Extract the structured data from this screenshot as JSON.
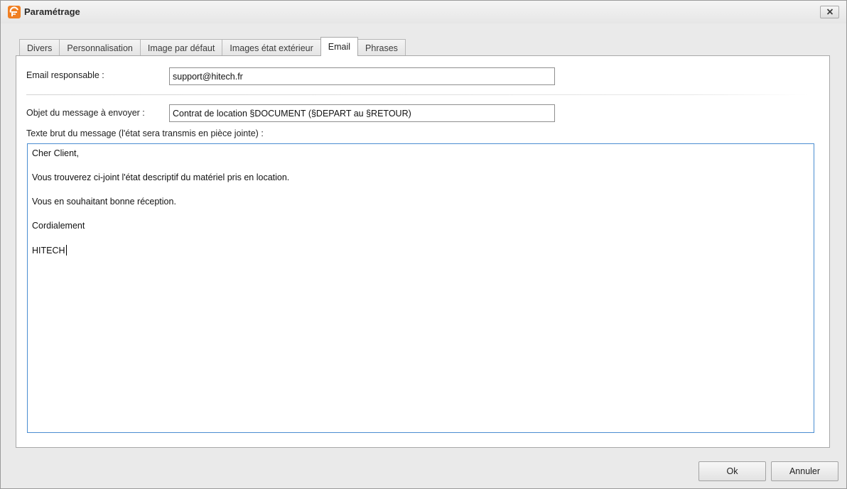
{
  "window": {
    "title": "Paramétrage",
    "close_label": "x"
  },
  "tabs": [
    {
      "label": "Divers",
      "active": false
    },
    {
      "label": "Personnalisation",
      "active": false
    },
    {
      "label": "Image par défaut",
      "active": false
    },
    {
      "label": "Images état extérieur",
      "active": false
    },
    {
      "label": "Email",
      "active": true
    },
    {
      "label": "Phrases",
      "active": false
    }
  ],
  "email_form": {
    "responsible_label": "Email responsable :",
    "responsible_value": "support@hitech.fr",
    "subject_label": "Objet du message à envoyer :",
    "subject_value": "Contrat de location §DOCUMENT (§DEPART au §RETOUR)",
    "body_label": "Texte brut du message (l'état sera transmis en pièce jointe) :",
    "body_lines": [
      "Cher Client,",
      "Vous trouverez ci-joint l'état descriptif du matériel pris en location.",
      "Vous en souhaitant bonne réception.",
      "Cordialement",
      "HITECH"
    ]
  },
  "footer": {
    "ok_label": "Ok",
    "cancel_label": "Annuler"
  },
  "colors": {
    "app_icon": "#f07f22",
    "focus_border": "#4a8dd1"
  }
}
